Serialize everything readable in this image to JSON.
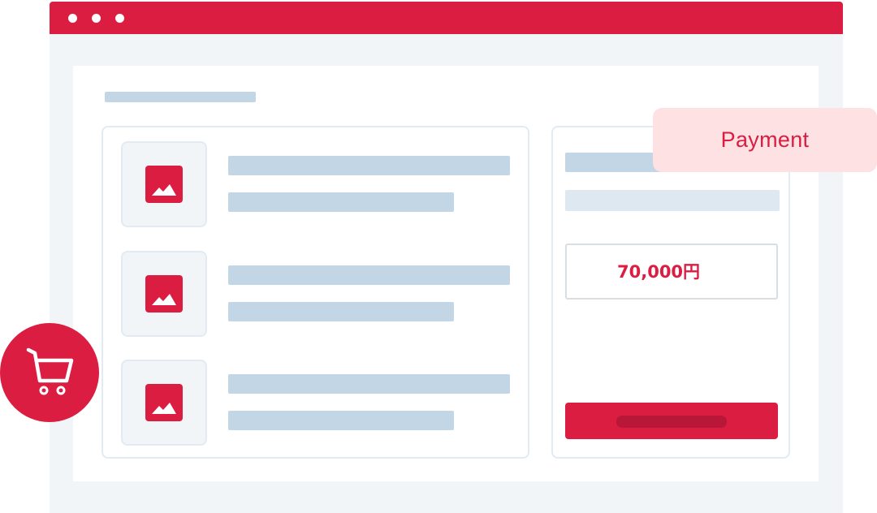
{
  "window": {
    "titlebar_color": "#dc1d42",
    "controls": [
      "window-dot",
      "window-dot",
      "window-dot"
    ]
  },
  "cart_list": {
    "items": [
      {
        "icon": "image-icon"
      },
      {
        "icon": "image-icon"
      },
      {
        "icon": "image-icon"
      }
    ]
  },
  "checkout": {
    "price": "70,000円",
    "tooltip": "Payment",
    "pay_button_icon": "none"
  },
  "floating": {
    "cart_icon": "shopping-cart-icon"
  },
  "colors": {
    "accent": "#dc1d42",
    "placeholder": "#c2d6e5",
    "background": "#f1f5f8"
  }
}
